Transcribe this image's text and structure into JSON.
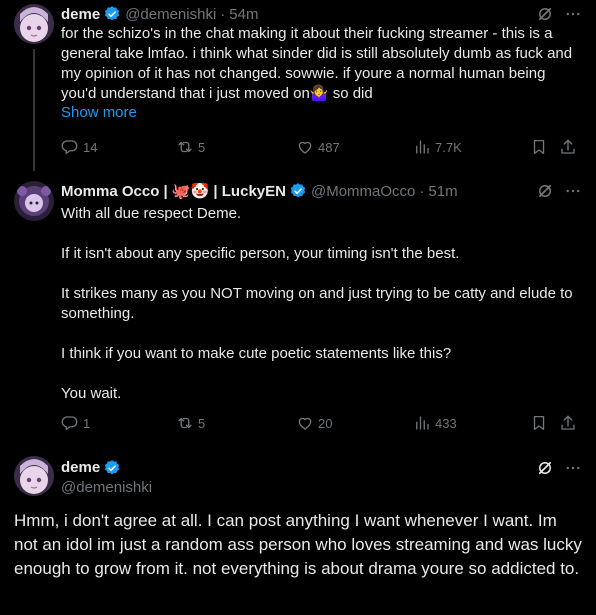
{
  "tweets": [
    {
      "name": "deme",
      "handle": "@demenishki",
      "time": "54m",
      "text": "for the schizo's in the chat making it about their fucking streamer - this is a general take lmfao. i think what sinder did is still absolutely dumb as fuck and my opinion of it has not changed. sowwie. if youre a normal human being you'd understand that i just moved on🤷‍♀️ so did",
      "show_more": "Show more",
      "replies": "14",
      "reposts": "5",
      "likes": "487",
      "views": "7.7K"
    },
    {
      "name": "Momma Occo | 🐙🤡 | LuckyEN",
      "handle": "@MommaOcco",
      "time": "51m",
      "text": "With all due respect Deme.\n\nIf it isn't about any specific person, your timing isn't the best.\n\nIt strikes many as you NOT moving on and just trying to be catty and elude to something.\n\nI think if you want to make cute poetic statements like this?\n\nYou wait.",
      "replies": "1",
      "reposts": "5",
      "likes": "20",
      "views": "433"
    },
    {
      "name": "deme",
      "handle": "@demenishki",
      "text": "Hmm, i don't agree at all. I can post anything I want whenever I want. Im not an idol im just a random ass person who loves streaming and was lucky enough to grow from it. not everything is about drama youre so addicted to."
    }
  ],
  "separator": "·",
  "colors": {
    "background": "#000000",
    "text": "#e7e9ea",
    "muted": "#71767b",
    "link": "#1d9bf0",
    "verified": "#1d9bf0"
  }
}
